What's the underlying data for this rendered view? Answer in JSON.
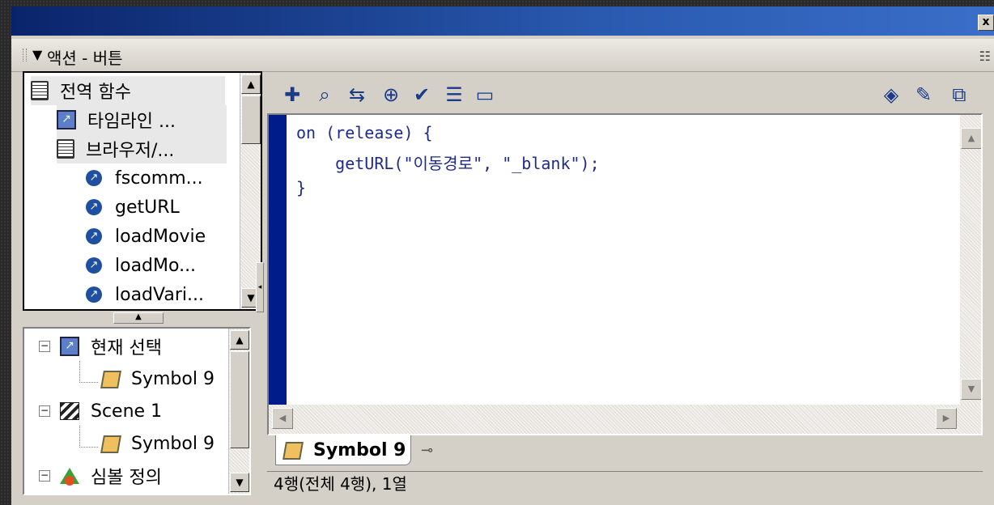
{
  "window": {
    "close_glyph": "x"
  },
  "panel": {
    "collapse_glyph": "▼",
    "title": "액션 - 버튼",
    "options_glyph": "☷"
  },
  "toolbox": {
    "items": [
      {
        "label": "전역 함수",
        "icon": "book-icon"
      },
      {
        "label": "타임라인 ...",
        "icon": "box-arrow-icon"
      },
      {
        "label": "브라우저/...",
        "icon": "book-icon"
      },
      {
        "label": "fscomm...",
        "icon": "action-circle-icon"
      },
      {
        "label": "getURL",
        "icon": "action-circle-icon"
      },
      {
        "label": "loadMovie",
        "icon": "action-circle-icon"
      },
      {
        "label": "loadMo...",
        "icon": "action-circle-icon"
      },
      {
        "label": "loadVari...",
        "icon": "action-circle-icon"
      }
    ]
  },
  "scene_tree": {
    "items": [
      {
        "label": "현재 선택",
        "icon": "box-arrow-icon",
        "expand": "−"
      },
      {
        "label": "Symbol 9",
        "icon": "symbol-icon"
      },
      {
        "label": "Scene 1",
        "icon": "clapper-icon",
        "expand": "−"
      },
      {
        "label": "Symbol 9",
        "icon": "symbol-icon"
      },
      {
        "label": "심볼 정의",
        "icon": "shapes-icon",
        "expand": "−"
      }
    ]
  },
  "editor": {
    "lines": [
      "on (release) {",
      "    getURL(\"이동경로\", \"_blank\");",
      "}"
    ]
  },
  "tab": {
    "label": "Symbol 9"
  },
  "status": {
    "text": "4행(전체 4행), 1열"
  },
  "colors": {
    "titlebar": "#0a246a",
    "gutter": "#001c8a",
    "code": "#1e2b8a"
  }
}
